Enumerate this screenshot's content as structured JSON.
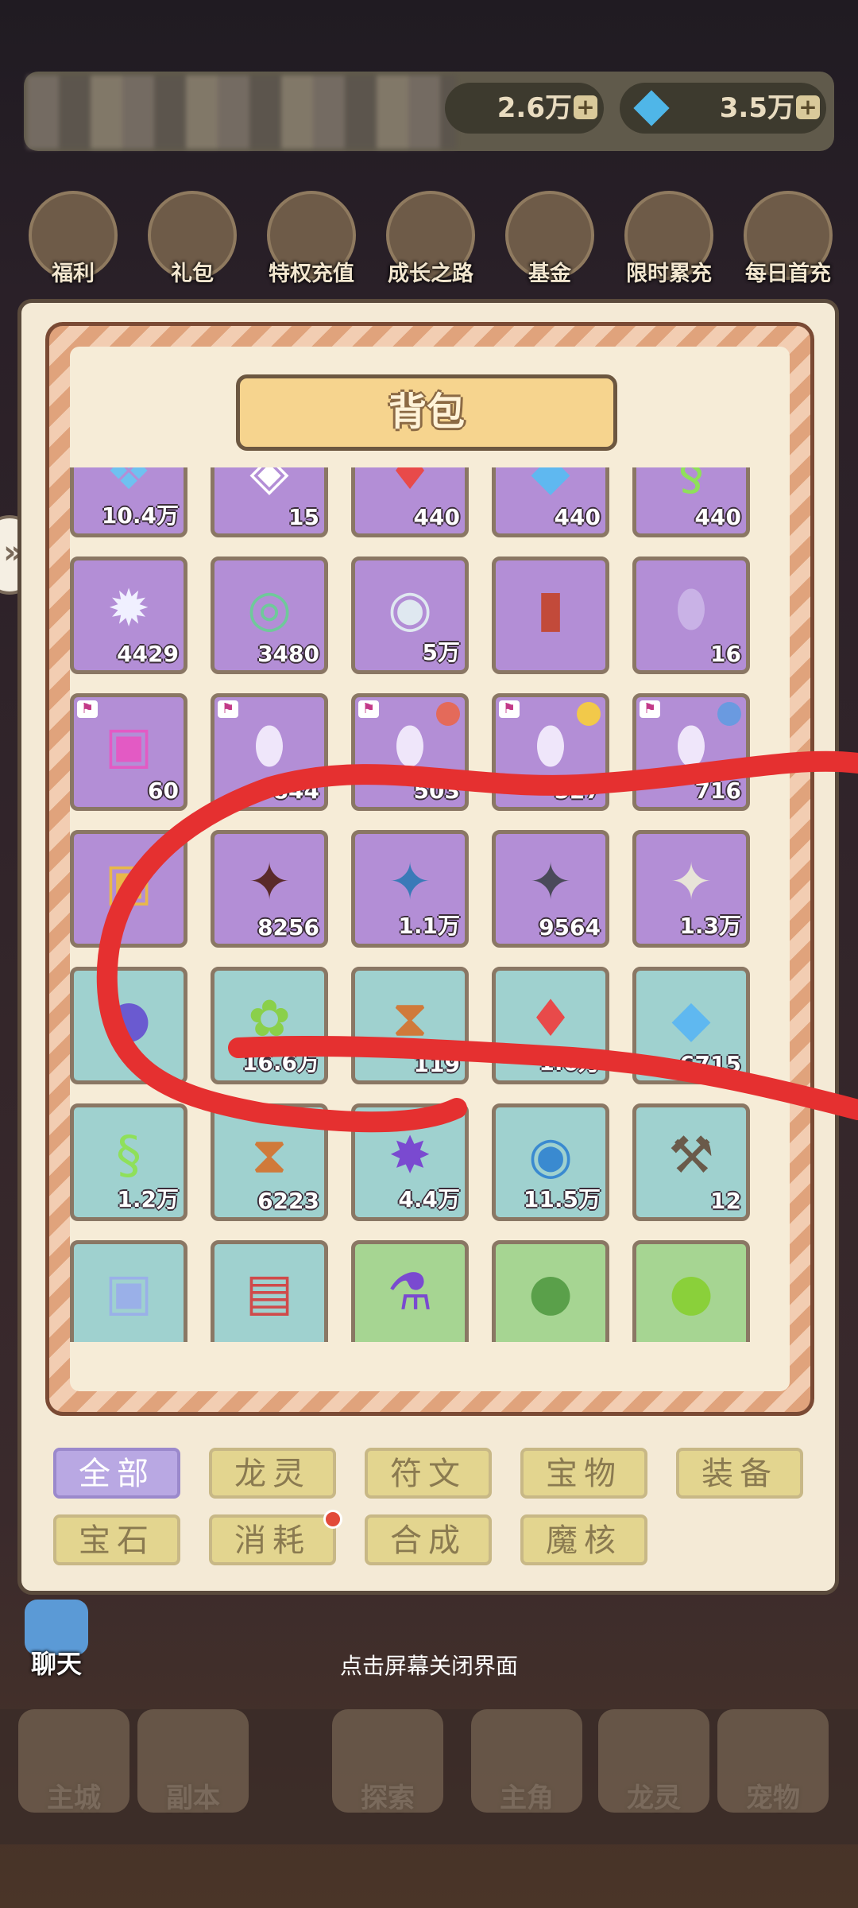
{
  "header": {
    "currency_1": "2.6万",
    "currency_2": "3.5万"
  },
  "top_icons": [
    {
      "label": "福利"
    },
    {
      "label": "礼包"
    },
    {
      "label": "特权充值"
    },
    {
      "label": "成长之路"
    },
    {
      "label": "基金"
    },
    {
      "label": "限时累充"
    },
    {
      "label": "每日首充"
    }
  ],
  "panel": {
    "title": "背包"
  },
  "items": [
    {
      "icon": "crystal-cube-icon",
      "glyph": "❖",
      "color": "purple",
      "tint": "#6fc1f0",
      "count": "10.4万"
    },
    {
      "icon": "white-flame-icon",
      "glyph": "◈",
      "color": "purple",
      "tint": "#ffffff",
      "count": "15"
    },
    {
      "icon": "red-flame-icon",
      "glyph": "♦",
      "color": "purple",
      "tint": "#e84a4a",
      "count": "440"
    },
    {
      "icon": "blue-crystal-icon",
      "glyph": "◆",
      "color": "purple",
      "tint": "#5fb8f0",
      "count": "440"
    },
    {
      "icon": "green-spirit-icon",
      "glyph": "§",
      "color": "purple",
      "tint": "#8fe05a",
      "count": "440"
    },
    {
      "icon": "spiked-orb-icon",
      "glyph": "✹",
      "color": "purple",
      "tint": "#f0f0ff",
      "count": "4429"
    },
    {
      "icon": "jade-ring-icon",
      "glyph": "◎",
      "color": "purple",
      "tint": "#6fc99a",
      "count": "3480"
    },
    {
      "icon": "silver-coin-icon",
      "glyph": "◉",
      "color": "purple",
      "tint": "#dfe8f0",
      "count": "5万"
    },
    {
      "icon": "dynamite-icon",
      "glyph": "▮",
      "color": "purple",
      "tint": "#c24a3a",
      "count": ""
    },
    {
      "icon": "stone-egg-icon",
      "glyph": "⬮",
      "color": "purple",
      "tint": "#c9b2e6",
      "count": "16"
    },
    {
      "icon": "pink-chest-icon",
      "glyph": "▣",
      "color": "purple",
      "tint": "#e35ac4",
      "count": "60",
      "tag": true
    },
    {
      "icon": "dragon-egg-icon",
      "glyph": "⬮",
      "color": "purple",
      "tint": "#efe6fa",
      "count": "844",
      "tag": true
    },
    {
      "icon": "dragon-egg-icon",
      "glyph": "⬮",
      "color": "purple",
      "tint": "#efe6fa",
      "count": "503",
      "tag": true,
      "badge": "#e46a5a"
    },
    {
      "icon": "dragon-egg-icon",
      "glyph": "⬮",
      "color": "purple",
      "tint": "#efe6fa",
      "count": "527",
      "tag": true,
      "badge": "#f2c94a"
    },
    {
      "icon": "dragon-egg-icon",
      "glyph": "⬮",
      "color": "purple",
      "tint": "#efe6fa",
      "count": "716",
      "tag": true,
      "badge": "#6a9ae0"
    },
    {
      "icon": "golden-chest-icon",
      "glyph": "▣",
      "color": "purple",
      "tint": "#e8b84a",
      "count": ""
    },
    {
      "icon": "dragon-puzzle-red-icon",
      "glyph": "✦",
      "color": "purple",
      "tint": "#5a2a2a",
      "count": "8256"
    },
    {
      "icon": "dragon-puzzle-blue-icon",
      "glyph": "✦",
      "color": "purple",
      "tint": "#3a7ab8",
      "count": "1.1万"
    },
    {
      "icon": "dragon-puzzle-dark-icon",
      "glyph": "✦",
      "color": "purple",
      "tint": "#4a4a5a",
      "count": "9564"
    },
    {
      "icon": "dragon-puzzle-white-icon",
      "glyph": "✦",
      "color": "purple",
      "tint": "#e8e4d8",
      "count": "1.3万"
    },
    {
      "icon": "purple-onion-icon",
      "glyph": "●",
      "color": "teal",
      "tint": "#6a5ad0",
      "count": ""
    },
    {
      "icon": "green-fruit-cluster-icon",
      "glyph": "✿",
      "color": "teal",
      "tint": "#8ad04a",
      "count": "16.6万"
    },
    {
      "icon": "hourglass-icon",
      "glyph": "⧗",
      "color": "teal",
      "tint": "#d07a3a",
      "count": "119"
    },
    {
      "icon": "red-flame-icon",
      "glyph": "♦",
      "color": "teal",
      "tint": "#e84a4a",
      "count": "1.6万"
    },
    {
      "icon": "blue-crystal-icon",
      "glyph": "◆",
      "color": "teal",
      "tint": "#5fb8f0",
      "count": "6715"
    },
    {
      "icon": "green-spirit-icon",
      "glyph": "§",
      "color": "teal",
      "tint": "#8fe05a",
      "count": "1.2万"
    },
    {
      "icon": "hourglass-icon",
      "glyph": "⧗",
      "color": "teal",
      "tint": "#d07a3a",
      "count": "6223"
    },
    {
      "icon": "purple-star-crystal-icon",
      "glyph": "✸",
      "color": "teal",
      "tint": "#7a4ad0",
      "count": "4.4万"
    },
    {
      "icon": "blue-portal-coin-icon",
      "glyph": "◉",
      "color": "teal",
      "tint": "#3a8ad0",
      "count": "11.5万"
    },
    {
      "icon": "pickaxe-icon",
      "glyph": "⚒",
      "color": "teal",
      "tint": "#6a5a4a",
      "count": "12"
    },
    {
      "icon": "silver-chest-icon",
      "glyph": "▣",
      "color": "teal",
      "tint": "#9ab0e8",
      "count": ""
    },
    {
      "icon": "gift-box-icon",
      "glyph": "▤",
      "color": "teal",
      "tint": "#d04a4a",
      "count": ""
    },
    {
      "icon": "potion-bottle-icon",
      "glyph": "⚗",
      "color": "green",
      "tint": "#7a4ad0",
      "count": ""
    },
    {
      "icon": "green-onion-icon",
      "glyph": "●",
      "color": "green",
      "tint": "#5aa04a",
      "count": ""
    },
    {
      "icon": "green-apple-icon",
      "glyph": "●",
      "color": "green",
      "tint": "#8ad03a",
      "count": ""
    }
  ],
  "tabs": [
    {
      "label": "全部",
      "active": true
    },
    {
      "label": "龙灵"
    },
    {
      "label": "符文"
    },
    {
      "label": "宝物"
    },
    {
      "label": "装备"
    },
    {
      "label": "宝石"
    },
    {
      "label": "消耗",
      "dot": true
    },
    {
      "label": "合成"
    },
    {
      "label": "魔核"
    }
  ],
  "hint": "点击屏幕关闭界面",
  "chat_label": "聊天",
  "bottom_nav": [
    {
      "label": "主城"
    },
    {
      "label": "副本"
    },
    {
      "label": "探索"
    },
    {
      "label": "主角"
    },
    {
      "label": "龙灵"
    },
    {
      "label": "宠物"
    }
  ],
  "colors": {
    "slot_purple": "#b38ed6",
    "slot_teal": "#9fd1cf",
    "slot_green": "#a6d592",
    "tab_active": "#b9a8e3",
    "tab_default": "#e3d58f",
    "scribble": "#e53030"
  }
}
